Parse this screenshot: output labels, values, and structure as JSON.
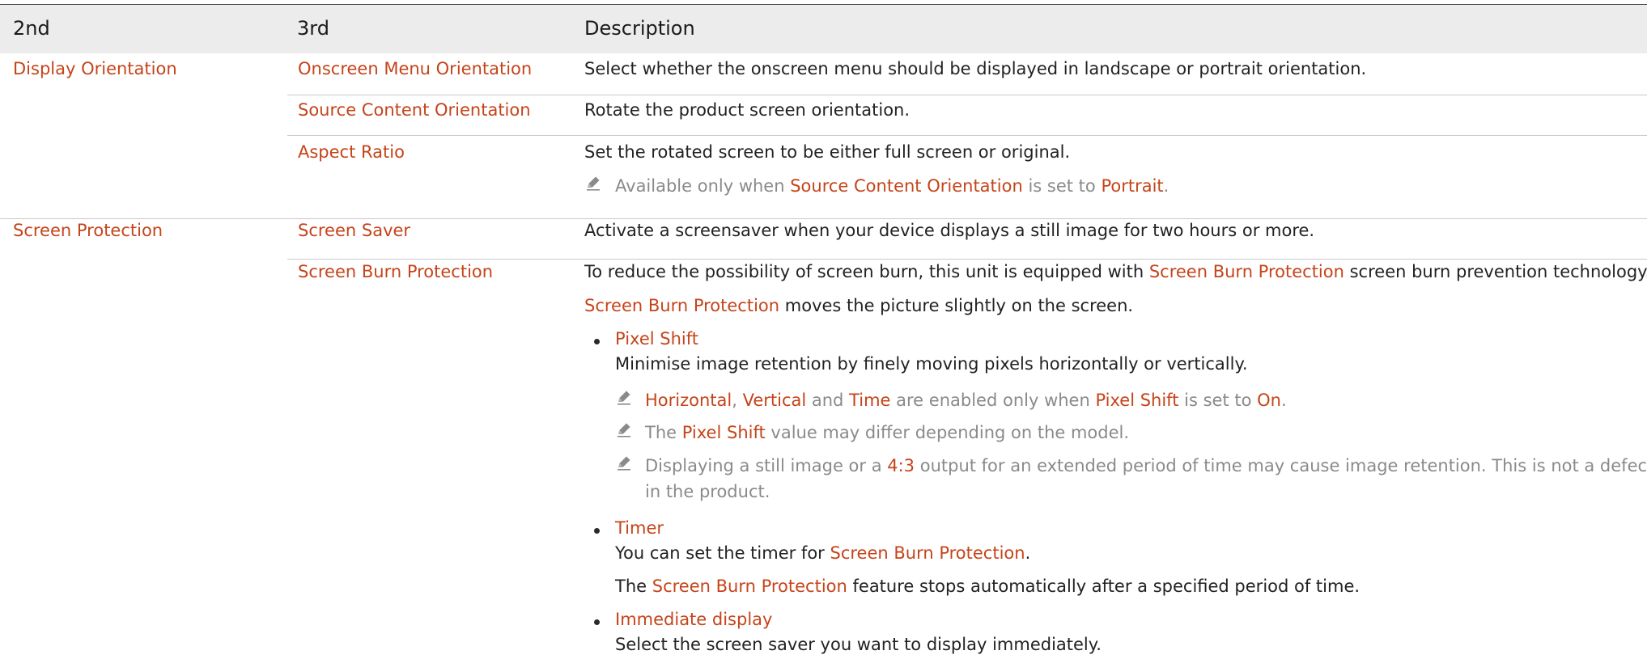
{
  "header": {
    "col2": "2nd",
    "col3": "3rd",
    "col_desc": "Description"
  },
  "rows": {
    "display_orientation": {
      "label": "Display Orientation",
      "onscreen_menu": {
        "label": "Onscreen Menu Orientation",
        "desc": "Select whether the onscreen menu should be displayed in landscape or portrait orientation."
      },
      "source_content": {
        "label": "Source Content Orientation",
        "desc": "Rotate the product screen orientation."
      },
      "aspect_ratio": {
        "label": "Aspect Ratio",
        "desc": "Set the rotated screen to be either full screen or original.",
        "note": {
          "a": "Available only when ",
          "b": "Source Content Orientation",
          "c": " is set to ",
          "d": "Portrait",
          "e": "."
        }
      }
    },
    "screen_protection": {
      "label": "Screen Protection",
      "screen_saver": {
        "label": "Screen Saver",
        "desc": "Activate a screensaver when your device displays a still image for two hours or more."
      },
      "burn_protection": {
        "label": "Screen Burn Protection",
        "p1": {
          "a": "To reduce the possibility of screen burn, this unit is equipped with ",
          "b": "Screen Burn Protection",
          "c": " screen burn prevention technology."
        },
        "p2": {
          "a": "Screen Burn Protection",
          "b": " moves the picture slightly on the screen."
        },
        "pixel_shift": {
          "title": "Pixel Shift",
          "desc": "Minimise image retention by finely moving pixels horizontally or vertically.",
          "note1": {
            "a": "Horizontal",
            "b": ", ",
            "c": "Vertical",
            "d": " and ",
            "e": "Time",
            "f": " are enabled only when ",
            "g": "Pixel Shift",
            "h": " is set to ",
            "i": "On",
            "j": "."
          },
          "note2": {
            "a": "The ",
            "b": "Pixel Shift",
            "c": " value may differ depending on the model."
          },
          "note3": {
            "a": "Displaying a still image or a ",
            "b": "4:3",
            "c": " output for an extended period of time may cause image retention. This is not a defect",
            "d": "in the product."
          }
        },
        "timer": {
          "title": "Timer",
          "line1": {
            "a": "You can set the timer for ",
            "b": "Screen Burn Protection",
            "c": "."
          },
          "line2": {
            "a": "The ",
            "b": "Screen Burn Protection",
            "c": " feature stops automatically after a specified period of time."
          }
        },
        "immediate": {
          "title": "Immediate display",
          "desc": "Select the screen saver you want to display immediately."
        }
      }
    }
  }
}
